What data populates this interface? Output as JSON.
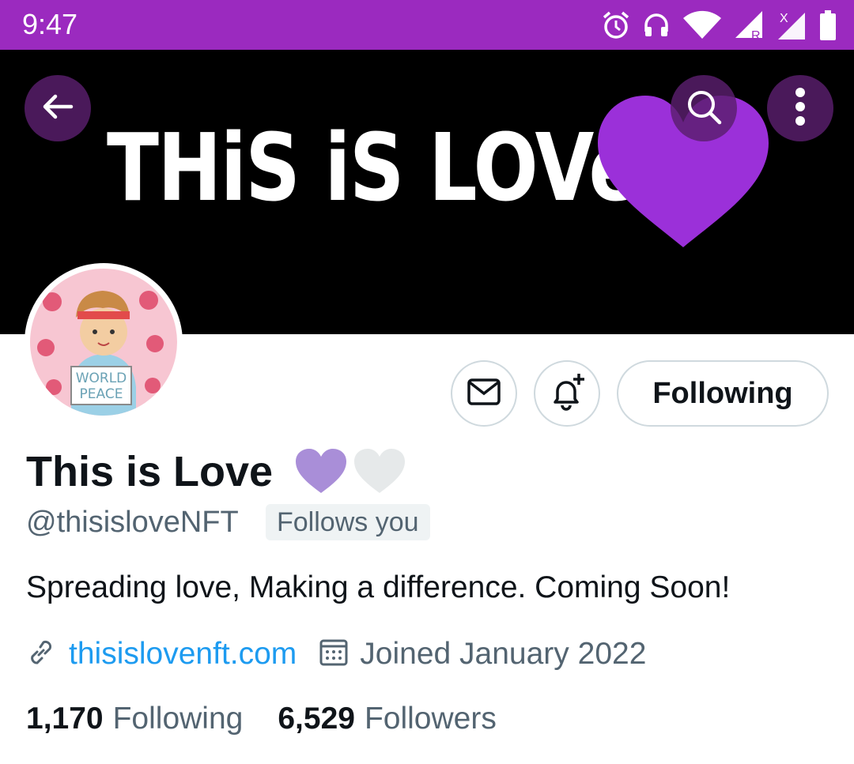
{
  "status_bar": {
    "time": "9:47",
    "background": "#9b2abf",
    "icons": [
      "alarm-icon",
      "headphones-icon",
      "wifi-icon",
      "signal-r-icon",
      "signal-x-icon",
      "battery-icon"
    ],
    "signal_badges": [
      "R",
      "X"
    ]
  },
  "banner": {
    "title": "THiS iS LOVe",
    "heart_color": "#9b30d9"
  },
  "header_buttons": {
    "back_icon": "arrow-left-icon",
    "search_icon": "search-icon",
    "more_icon": "more-vertical-icon"
  },
  "avatar": {
    "sign_line1": "WORLD",
    "sign_line2": "PEACE"
  },
  "actions": {
    "message_icon": "envelope-icon",
    "notify_icon": "bell-plus-icon",
    "following_label": "Following"
  },
  "profile": {
    "name": "This is Love",
    "name_hearts": [
      "#a98ed8",
      "#e6e9ea"
    ],
    "handle": "@thisisloveNFT",
    "follows_you": "Follows you",
    "bio": "Spreading love, Making a difference. Coming Soon!",
    "website": "thisislovenft.com",
    "joined": "Joined January 2022"
  },
  "stats": {
    "following_count": "1,170",
    "following_label": "Following",
    "followers_count": "6,529",
    "followers_label": "Followers"
  },
  "colors": {
    "link": "#1d9bf0",
    "secondary_text": "#536471",
    "primary_text": "#0f1419"
  }
}
